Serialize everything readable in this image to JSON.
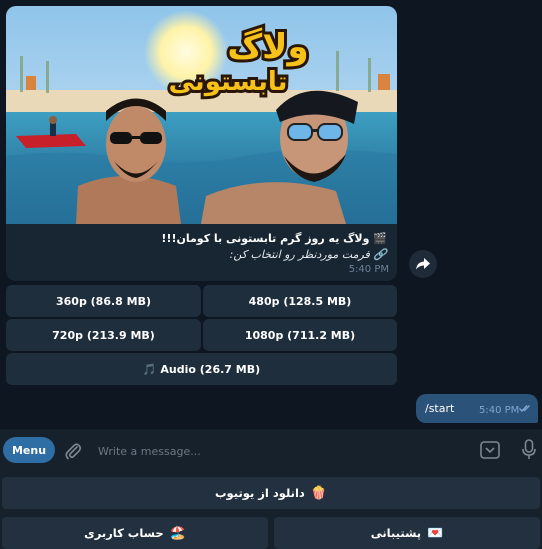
{
  "message": {
    "thumbnail_title_line1": "ولاگ",
    "thumbnail_title_line2": "تابستونی",
    "caption_line1": "🎬 ولاگ یه روز گرم تابستونی با کومان!!!",
    "caption_line2": "🔗 فرمت موردنظر رو انتخاب کن:",
    "time": "5:40 PM"
  },
  "inline_keyboard": {
    "btn_360": "360p (86.8 MB)",
    "btn_480": "480p (128.5 MB)",
    "btn_720": "720p (213.9 MB)",
    "btn_1080": "1080p (711.2 MB)",
    "btn_audio": "🎵 Audio (26.7 MB)"
  },
  "outgoing": {
    "text": "/start",
    "time": "5:40 PM"
  },
  "composer": {
    "menu_label": "Menu",
    "placeholder": "Write a message..."
  },
  "reply_keyboard": {
    "youtube_download": "دانلود از یوتیوب",
    "youtube_emoji": "🍿",
    "account": "حساب کاربری",
    "account_emoji": "🏖️",
    "support": "پشتیبانی",
    "support_emoji": "💌"
  },
  "colors": {
    "background": "#0e1621",
    "bubble_in": "#182533",
    "bubble_out": "#2b5278",
    "accent": "#2f6ea5"
  }
}
